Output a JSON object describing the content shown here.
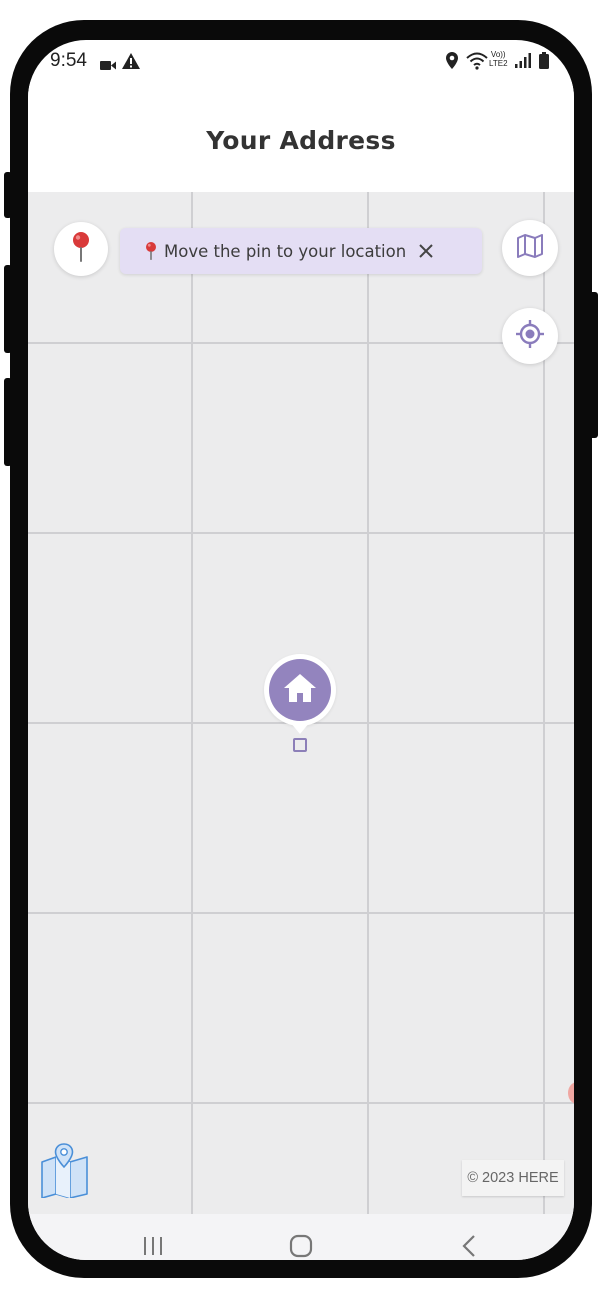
{
  "status_bar": {
    "time": "9:54",
    "icons": [
      "video-camera-icon",
      "warning-icon",
      "location-icon",
      "wifi-icon",
      "volte-icon",
      "signal-icon",
      "battery-icon"
    ],
    "volte_top": "Vo))",
    "volte_bottom": "LTE2"
  },
  "header": {
    "title": "Your Address"
  },
  "map": {
    "hint_banner": {
      "icon": "pushpin-icon",
      "text": "Move the pin to your location",
      "close_icon": "close-icon"
    },
    "buttons": {
      "pin": "pushpin-icon",
      "map_layers": "map-icon",
      "locate": "crosshair-icon"
    },
    "center_marker": "home-icon",
    "logo": "map-folded-icon",
    "copyright": "© 2023 HERE"
  },
  "nav_bar": {
    "buttons": [
      "recent-apps-icon",
      "home-button-icon",
      "back-icon"
    ]
  },
  "colors": {
    "accent": "#9384be",
    "banner_bg": "#e4def4",
    "map_bg": "#ececed",
    "grid": "#cfcfd2",
    "pin_red": "#d93a3a"
  }
}
